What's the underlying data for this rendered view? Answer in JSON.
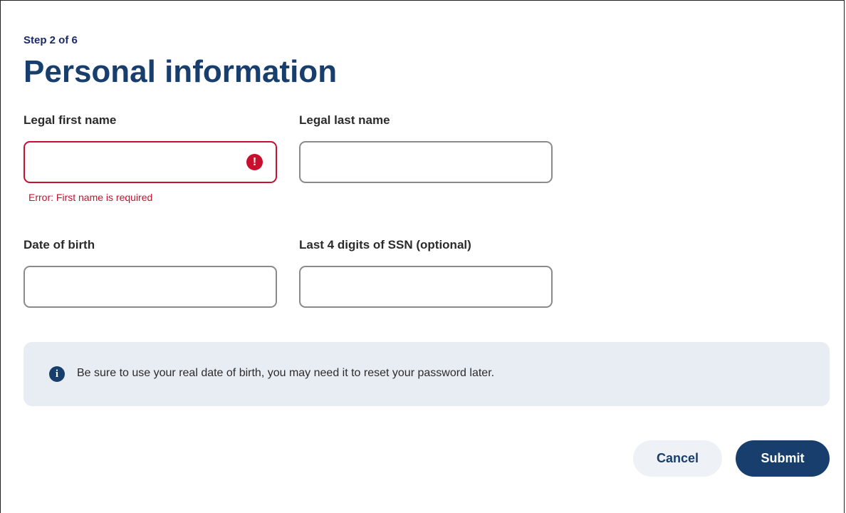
{
  "header": {
    "step": "Step 2 of 6",
    "title": "Personal information"
  },
  "form": {
    "first_name": {
      "label": "Legal first name",
      "value": "",
      "placeholder": "",
      "error": "Error:  First name is required",
      "error_icon": "!"
    },
    "last_name": {
      "label": "Legal last name",
      "value": "",
      "placeholder": ""
    },
    "dob": {
      "label": "Date of birth",
      "value": "",
      "placeholder": ""
    },
    "ssn": {
      "label": "Last 4 digits of SSN (optional)",
      "value": "",
      "placeholder": ""
    }
  },
  "info": {
    "icon": "i",
    "icon_name": "info-icon",
    "text": "Be sure to use your real date of birth, you may need it to reset your password later."
  },
  "actions": {
    "cancel": "Cancel",
    "submit": "Submit"
  },
  "colors": {
    "primary": "#173e6c",
    "error": "#c8102e",
    "info_bg": "#e8edf3"
  }
}
